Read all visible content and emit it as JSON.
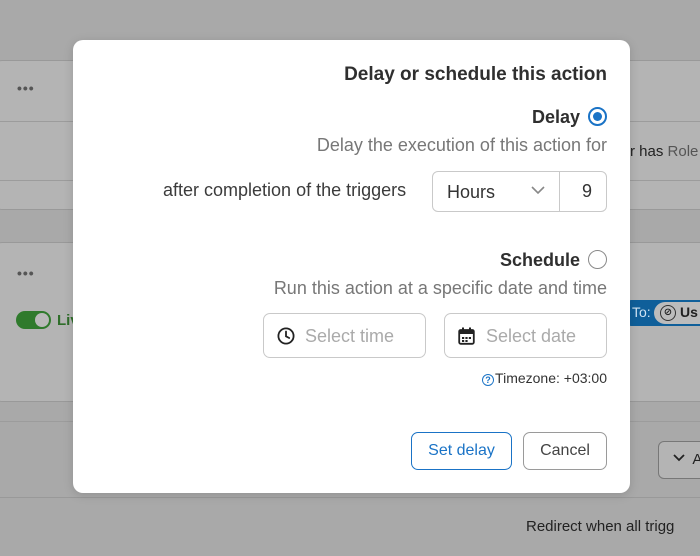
{
  "background": {
    "dots_1": "•••",
    "dots_2": "•••",
    "row_text_prefix": "r has",
    "row_text_suffix": "Role",
    "toggle_label": "Liv",
    "chip_prefix": "To:",
    "chip_label": "Us",
    "button_label": "A",
    "footer_text": "Redirect when all trigg"
  },
  "modal": {
    "title": "Delay or schedule this action",
    "delay": {
      "label": "Delay",
      "selected": true,
      "description": "Delay the execution of this action for",
      "after_text": "after completion of the triggers",
      "unit_value": "Hours",
      "amount_value": "9"
    },
    "schedule": {
      "label": "Schedule",
      "selected": false,
      "description": "Run this action at a specific date and time",
      "time_placeholder": "Select time",
      "date_placeholder": "Select date"
    },
    "timezone": {
      "help_icon": "?",
      "label": "Timezone:",
      "value": "+03:00"
    },
    "buttons": {
      "set_delay": "Set delay",
      "cancel": "Cancel"
    }
  },
  "colors": {
    "accent": "#1a73c6",
    "overlay": "#a9a9a9",
    "live_green": "#2f7a2c",
    "chip_blue": "#0f5f9a"
  },
  "icons": [
    "clock-icon",
    "calendar-icon",
    "chevron-down-icon",
    "help-icon",
    "more-dots-icon"
  ]
}
